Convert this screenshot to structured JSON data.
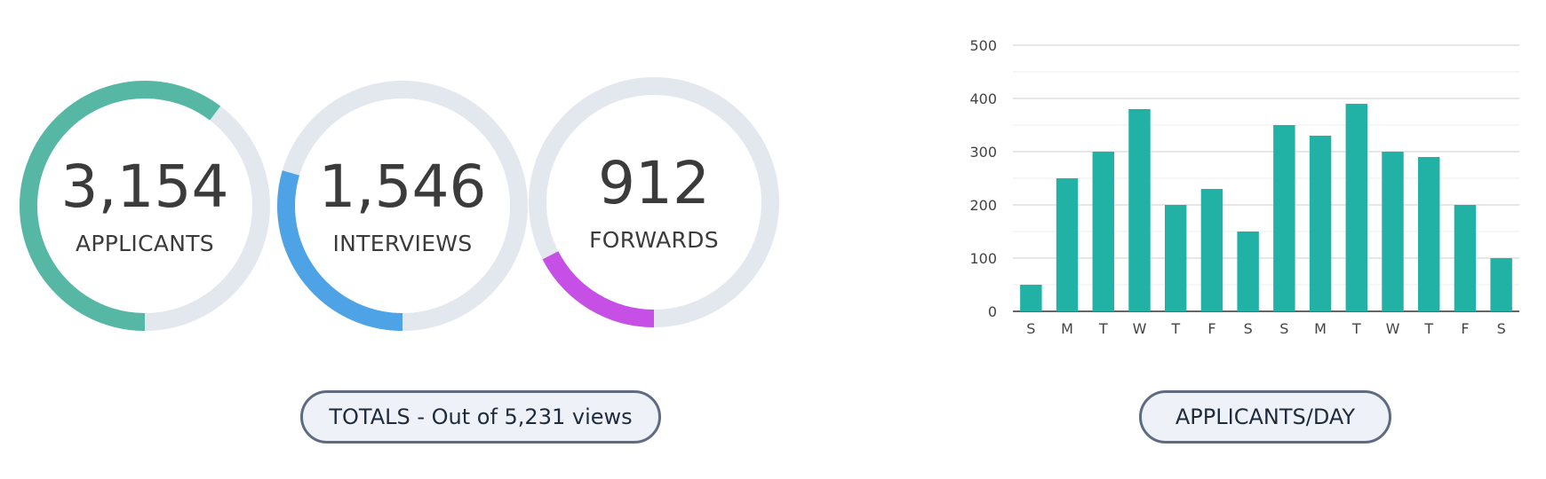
{
  "stats": [
    {
      "value": "3,154",
      "label": "APPLICANTS",
      "fraction": 0.603,
      "color": "#56b8a4",
      "track": "#e3e8ef"
    },
    {
      "value": "1,546",
      "label": "INTERVIEWS",
      "fraction": 0.2956,
      "color": "#4ea3e6",
      "track": "#e3e8ef"
    },
    {
      "value": "912",
      "label": "FORWARDS",
      "fraction": 0.1744,
      "color": "#c64fe6",
      "track": "#e3e8ef"
    }
  ],
  "totals_pill": "TOTALS - Out of 5,231 views",
  "chart_pill": "APPLICANTS/DAY",
  "chart_data": {
    "type": "bar",
    "categories": [
      "S",
      "M",
      "T",
      "W",
      "T",
      "F",
      "S",
      "S",
      "M",
      "T",
      "W",
      "T",
      "F",
      "S"
    ],
    "values": [
      50,
      250,
      300,
      380,
      200,
      230,
      150,
      350,
      330,
      390,
      300,
      290,
      200,
      100
    ],
    "ylim": [
      0,
      500
    ],
    "yticks": [
      0,
      100,
      200,
      300,
      400,
      500
    ],
    "grid": true,
    "bar_color": "#22b1a5",
    "title": "",
    "xlabel": "",
    "ylabel": ""
  }
}
